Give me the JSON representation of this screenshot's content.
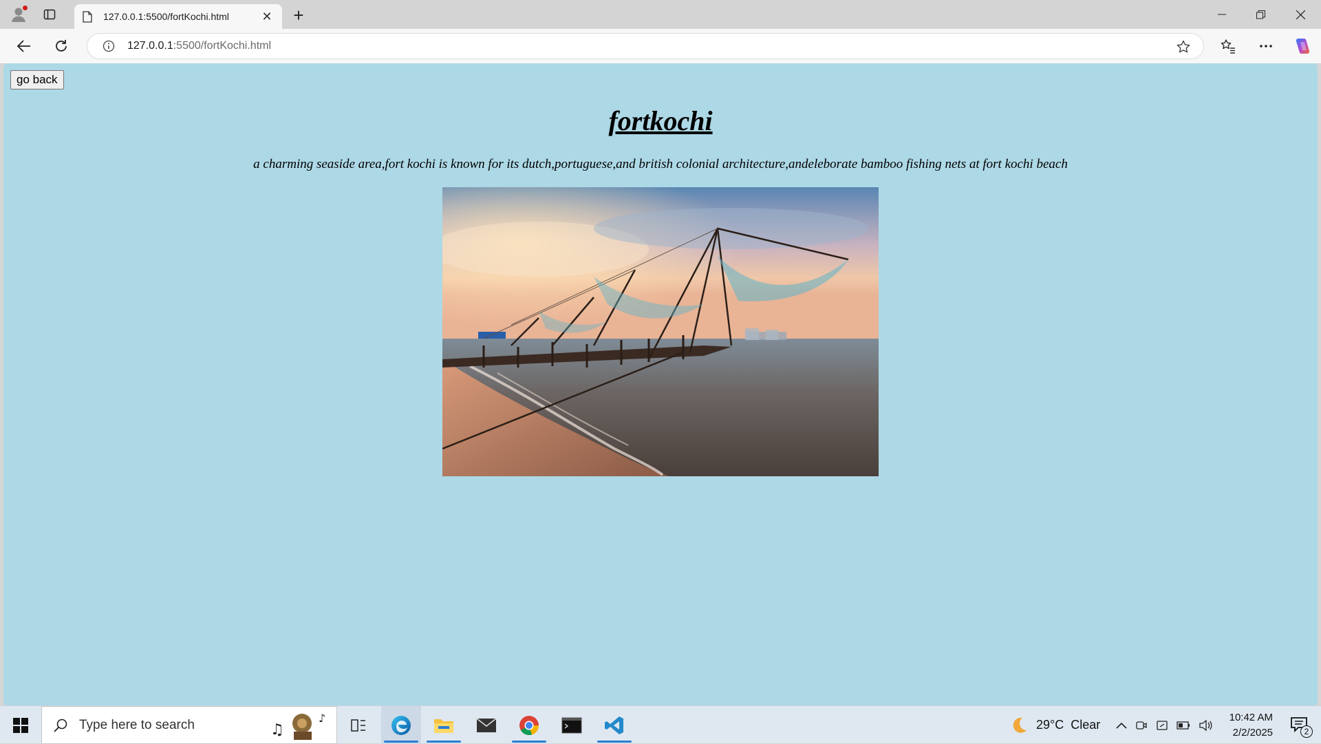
{
  "browser": {
    "tab_title": "127.0.0.1:5500/fortKochi.html",
    "url_host": "127.0.0.1",
    "url_rest": ":5500/fortKochi.html"
  },
  "page": {
    "go_back_label": "go back",
    "title": "fortkochi",
    "description": "a charming seaside area,fort kochi is known for its dutch,portuguese,and british colonial architecture,andeleborate bamboo fishing nets at fort kochi beach"
  },
  "taskbar": {
    "search_placeholder": "Type here to search",
    "weather_temp": "29°C",
    "weather_cond": "Clear",
    "time": "10:42 AM",
    "date": "2/2/2025",
    "notification_count": "2"
  },
  "colors": {
    "page_background": "#add8e6",
    "browser_frame": "#d4d4d4"
  }
}
